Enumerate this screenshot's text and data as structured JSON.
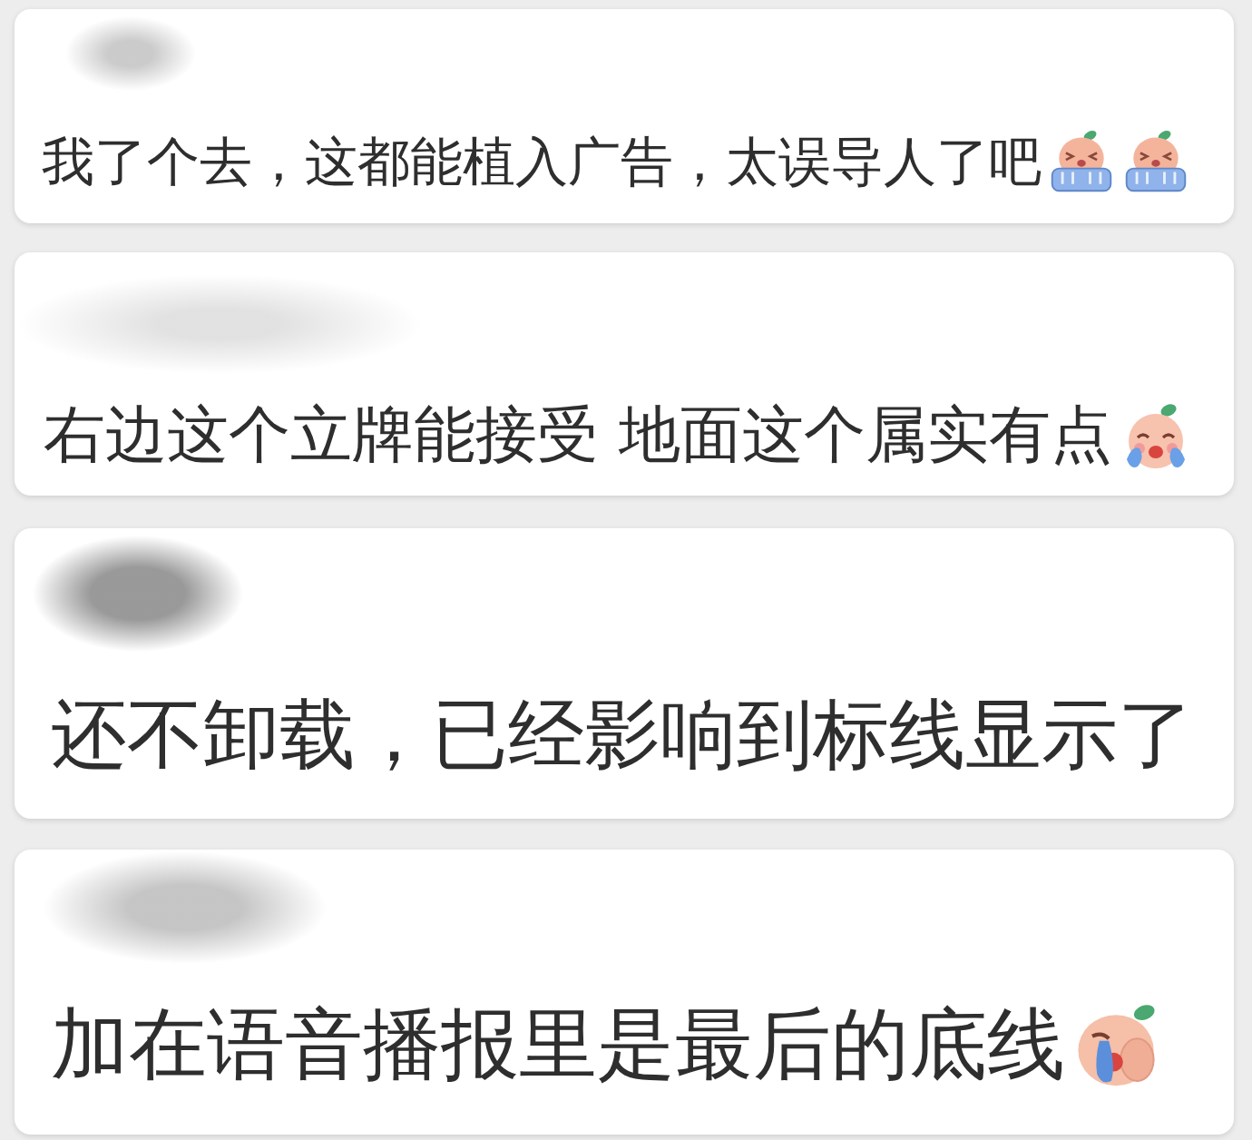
{
  "comments": [
    {
      "username_redacted": true,
      "text": "我了个去，这都能植入广告，太误导人了吧",
      "emojis": [
        {
          "kind": "tub"
        },
        {
          "kind": "tub"
        }
      ]
    },
    {
      "username_redacted": true,
      "text": "右边这个立牌能接受 地面这个属实有点",
      "emojis": [
        {
          "kind": "crying"
        }
      ]
    },
    {
      "username_redacted": true,
      "text": "还不卸载，已经影响到标线显示了"
    },
    {
      "username_redacted": true,
      "text": "加在语音播报里是最后的底线",
      "emojis": [
        {
          "kind": "wailing"
        }
      ]
    }
  ]
}
